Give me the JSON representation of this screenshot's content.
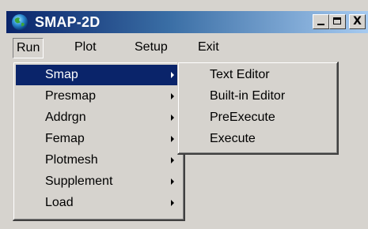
{
  "window": {
    "title": "SMAP-2D",
    "controls": {
      "minimize": "_",
      "maximize": "□",
      "close": "X"
    }
  },
  "menubar": [
    {
      "id": "run",
      "label": "Run",
      "open": true
    },
    {
      "id": "plot",
      "label": "Plot"
    },
    {
      "id": "setup",
      "label": "Setup"
    },
    {
      "id": "exit",
      "label": "Exit"
    }
  ],
  "run_menu": [
    {
      "label": "Smap",
      "has_submenu": true,
      "selected": true
    },
    {
      "label": "Presmap",
      "has_submenu": true
    },
    {
      "label": "Addrgn",
      "has_submenu": true
    },
    {
      "label": "Femap",
      "has_submenu": true
    },
    {
      "label": "Plotmesh",
      "has_submenu": true
    },
    {
      "label": "Supplement",
      "has_submenu": true
    },
    {
      "label": "Load",
      "has_submenu": true
    }
  ],
  "smap_submenu": [
    {
      "label": "Text Editor"
    },
    {
      "label": "Built-in Editor"
    },
    {
      "label": "PreExecute"
    },
    {
      "label": "Execute"
    }
  ],
  "colors": {
    "title_bar_start": "#0a246a",
    "title_bar_end": "#a6caf0",
    "menu_face": "#d6d3ce",
    "highlight": "#0a246a"
  },
  "icons": {
    "app": "globe-icon"
  }
}
